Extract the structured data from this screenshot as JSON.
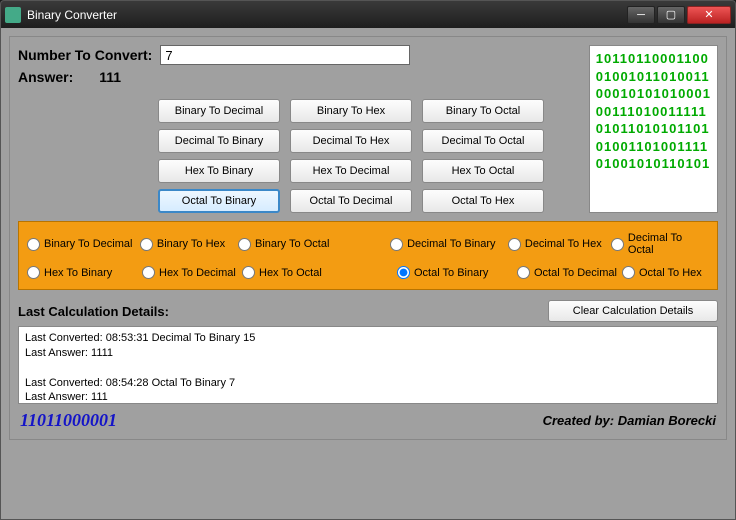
{
  "window": {
    "title": "Binary Converter"
  },
  "input": {
    "label": "Number To Convert:",
    "value": "7"
  },
  "answer": {
    "label": "Answer:",
    "value": "111"
  },
  "buttons": {
    "r0c0": "Binary To Decimal",
    "r0c1": "Binary To Hex",
    "r0c2": "Binary To Octal",
    "r1c0": "Decimal To Binary",
    "r1c1": "Decimal To Hex",
    "r1c2": "Decimal To Octal",
    "r2c0": "Hex To Binary",
    "r2c1": "Hex To Decimal",
    "r2c2": "Hex To Octal",
    "r3c0": "Octal To Binary",
    "r3c1": "Octal To Decimal",
    "r3c2": "Octal To Hex"
  },
  "art": {
    "l0": "10110110001100",
    "l1": "01001011010011",
    "l2": "00010101010001",
    "l3": "00111010011111",
    "l4": "01011010101101",
    "l5": "01001101001111",
    "l6": "01001010110101"
  },
  "radios": {
    "r0": "Binary To Decimal",
    "r1": "Binary To Hex",
    "r2": "Binary To Octal",
    "r3": "Decimal To Binary",
    "r4": "Decimal To Hex",
    "r5": "Decimal To Octal",
    "r6": "Hex To Binary",
    "r7": "Hex To Decimal",
    "r8": "Hex To Octal",
    "r9": "Octal To Binary",
    "r10": "Octal To Decimal",
    "r11": "Octal To Hex"
  },
  "details": {
    "header": "Last Calculation Details:",
    "clear": "Clear Calculation Details",
    "l0": "Last Converted: 08:53:31  Decimal To Binary 15",
    "l1": "Last Answer: 1111",
    "l2": "Last Converted: 08:54:28  Octal To Binary 7",
    "l3": "Last Answer: 111"
  },
  "footer": {
    "binary": "11011000001",
    "credit": "Created by: Damian Borecki"
  }
}
